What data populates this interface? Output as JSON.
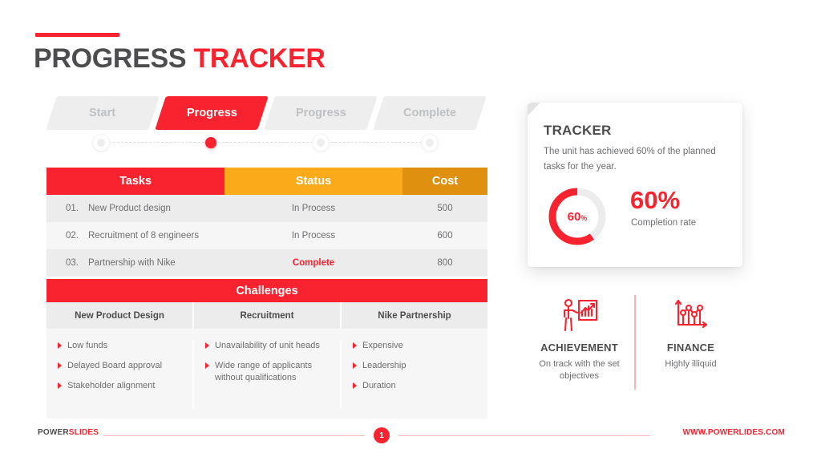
{
  "slide": {
    "title_part1": "PROGRESS ",
    "title_part2": "TRACKER",
    "accent_color": "#f8232f"
  },
  "steps": [
    {
      "label": "Start",
      "state": "inactive"
    },
    {
      "label": "Progress",
      "state": "active"
    },
    {
      "label": "Progress",
      "state": "inactive"
    },
    {
      "label": "Complete",
      "state": "inactive"
    }
  ],
  "tasks_table": {
    "headers": {
      "tasks": "Tasks",
      "status": "Status",
      "cost": "Cost"
    },
    "header_colors": {
      "tasks": "#f8232f",
      "status": "#fbaa19",
      "cost": "#e0900f"
    },
    "rows": [
      {
        "num": "01.",
        "task": "New Product design",
        "status": "In Process",
        "cost": "500",
        "complete": false
      },
      {
        "num": "02.",
        "task": "Recruitment of 8 engineers",
        "status": "In Process",
        "cost": "600",
        "complete": false
      },
      {
        "num": "03.",
        "task": "Partnership with Nike",
        "status": "Complete",
        "cost": "800",
        "complete": true
      }
    ]
  },
  "challenges": {
    "title": "Challenges",
    "columns": [
      {
        "heading": "New Product Design",
        "items": [
          "Low funds",
          "Delayed Board approval",
          "Stakeholder alignment"
        ]
      },
      {
        "heading": "Recruitment",
        "items": [
          "Unavailability of unit heads",
          "Wide range of applicants without qualifications"
        ]
      },
      {
        "heading": "Nike Partnership",
        "items": [
          "Expensive",
          "Leadership",
          "Duration"
        ]
      }
    ]
  },
  "tracker_card": {
    "title": "TRACKER",
    "description": "The unit has achieved 60% of the planned tasks for the year.",
    "donut_value": 60,
    "donut_label_number": "60",
    "donut_label_unit": "%",
    "big_percent": "60%",
    "completion_label": "Completion rate"
  },
  "kpis": [
    {
      "icon": "presenter-chart-icon",
      "title": "ACHIEVEMENT",
      "description": "On track with the set objectives"
    },
    {
      "icon": "line-chart-icon",
      "title": "FINANCE",
      "description": "Highly illiquid"
    }
  ],
  "footer": {
    "brand_part1": "POWER",
    "brand_part2": "SLIDES",
    "page_number": "1",
    "url": "WWW.POWERLIDES.COM"
  }
}
